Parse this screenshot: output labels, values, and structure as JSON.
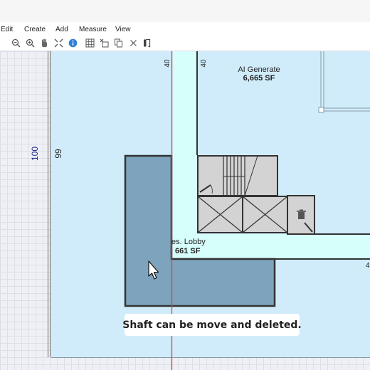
{
  "menu": {
    "edit": "Edit",
    "create": "Create",
    "add": "Add",
    "measure": "Measure",
    "view": "View"
  },
  "toolbar": {
    "icons": [
      "zoom-out-icon",
      "zoom-in-icon",
      "hand-icon",
      "fit-icon",
      "info-icon",
      "grid-icon",
      "remove-grid-icon",
      "copy-icon",
      "close-icon",
      "door-icon"
    ],
    "info_color": "#2f7fd6"
  },
  "plan": {
    "room_name": "AI Generate",
    "room_area": "6,665 SF",
    "lobby_name": "es. Lobby",
    "lobby_area": "661 SF",
    "dim_left_outer": "100",
    "dim_left_inner": "99",
    "dim_corridor_left": "40",
    "dim_corridor_right": "40",
    "dim_right_edge": "4",
    "colors": {
      "room_fill": "#d0ecfb",
      "corridor_fill": "#d6fefb",
      "shaft_fill": "#7da4bc",
      "wall": "#333333",
      "guide_line": "#d14a3a"
    }
  },
  "caption": "Shaft can be move and deleted."
}
